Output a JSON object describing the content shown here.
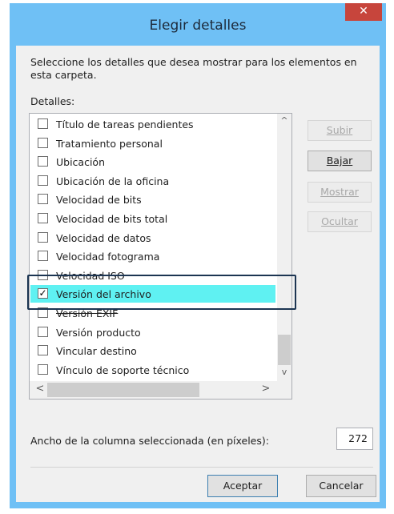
{
  "window": {
    "title": "Elegir detalles",
    "close_glyph": "✕",
    "accent_color": "#6fc0f5",
    "close_color": "#c7453c"
  },
  "description": "Seleccione los detalles que desea mostrar para los elementos en esta carpeta.",
  "details_label": "Detalles:",
  "list": {
    "items": [
      {
        "label": "Título de tareas pendientes",
        "checked": false
      },
      {
        "label": "Tratamiento personal",
        "checked": false
      },
      {
        "label": "Ubicación",
        "checked": false
      },
      {
        "label": "Ubicación de la oficina",
        "checked": false
      },
      {
        "label": "Velocidad de bits",
        "checked": false
      },
      {
        "label": "Velocidad de bits total",
        "checked": false
      },
      {
        "label": "Velocidad de datos",
        "checked": false
      },
      {
        "label": "Velocidad fotograma",
        "checked": false
      },
      {
        "label": "Velocidad ISO",
        "checked": false
      },
      {
        "label": "Versión del archivo",
        "checked": true,
        "selected": true
      },
      {
        "label": "Versión EXIF",
        "checked": false
      },
      {
        "label": "Versión producto",
        "checked": false
      },
      {
        "label": "Vincular destino",
        "checked": false
      },
      {
        "label": "Vínculo de soporte técnico",
        "checked": false
      }
    ],
    "selected_color": "#5ff1f2"
  },
  "buttons": {
    "subir": "Subir",
    "bajar": "Bajar",
    "mostrar": "Mostrar",
    "ocultar": "Ocultar",
    "aceptar": "Aceptar",
    "cancelar": "Cancelar"
  },
  "width_field": {
    "label": "Ancho de la columna seleccionada (en píxeles):",
    "value": "272"
  },
  "scroll_glyphs": {
    "up": "^",
    "down": "v",
    "left": "<",
    "right": ">"
  }
}
